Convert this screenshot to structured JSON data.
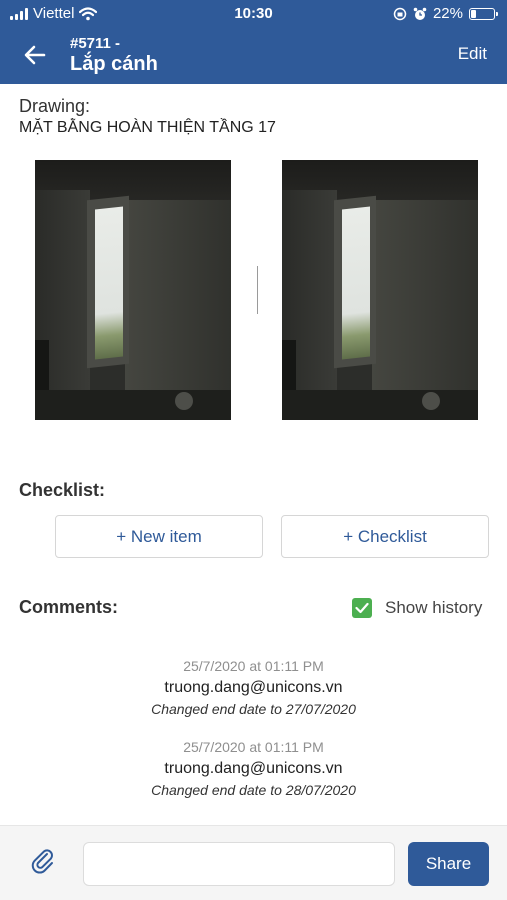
{
  "status_bar": {
    "carrier": "Viettel",
    "time": "10:30",
    "battery": "22%",
    "battery_level": 0.22,
    "icons": [
      "signal-icon",
      "wifi-icon",
      "screen-lock-icon",
      "alarm-icon",
      "battery-icon"
    ]
  },
  "header": {
    "code": "#5711 -",
    "title": "Lắp cánh",
    "edit_label": "Edit",
    "back_icon": "back-arrow-icon",
    "color": "#2f5a99"
  },
  "drawing": {
    "label": "Drawing:",
    "name": "MẶT BẰNG HOÀN THIỆN TẦNG  17"
  },
  "photos": [
    {
      "name": "photo-1"
    },
    {
      "name": "photo-2"
    }
  ],
  "checklist": {
    "label": "Checklist:",
    "new_item_label": "+ New item",
    "add_checklist_label": "+ Checklist"
  },
  "comments": {
    "label": "Comments:",
    "show_history_label": "Show history",
    "show_history_checked": true,
    "checkbox_color": "#4caf50",
    "items": [
      {
        "date": "25/7/2020 at 01:11 PM",
        "user": "truong.dang@unicons.vn",
        "message": "Changed end date to 27/07/2020"
      },
      {
        "date": "25/7/2020 at 01:11 PM",
        "user": "truong.dang@unicons.vn",
        "message": "Changed end date to 28/07/2020"
      }
    ]
  },
  "composer": {
    "placeholder": "",
    "share_label": "Share",
    "attach_icon": "paperclip-icon"
  }
}
